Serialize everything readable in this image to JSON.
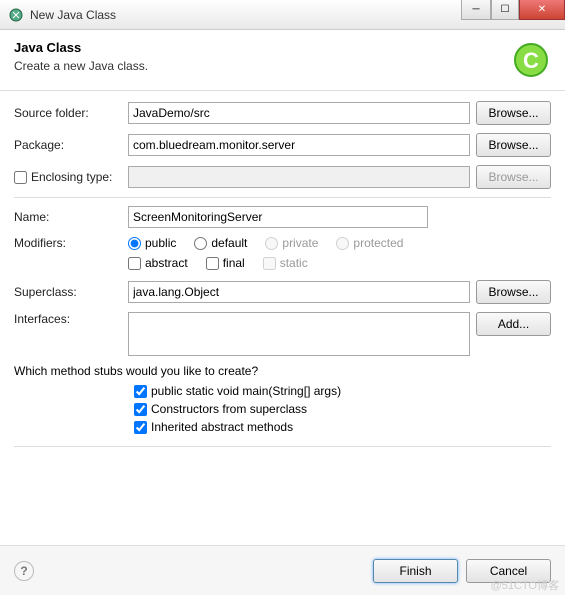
{
  "window": {
    "title": "New Java Class"
  },
  "header": {
    "title": "Java Class",
    "subtitle": "Create a new Java class."
  },
  "fields": {
    "source_folder_label": "Source folder:",
    "source_folder_value": "JavaDemo/src",
    "package_label": "Package:",
    "package_value": "com.bluedream.monitor.server",
    "enclosing_label": "Enclosing type:",
    "enclosing_value": "",
    "name_label": "Name:",
    "name_value": "ScreenMonitoringServer",
    "modifiers_label": "Modifiers:",
    "superclass_label": "Superclass:",
    "superclass_value": "java.lang.Object",
    "interfaces_label": "Interfaces:"
  },
  "modifiers": {
    "public": "public",
    "default": "default",
    "private": "private",
    "protected": "protected",
    "abstract": "abstract",
    "final": "final",
    "static": "static"
  },
  "buttons": {
    "browse": "Browse...",
    "add": "Add...",
    "finish": "Finish",
    "cancel": "Cancel"
  },
  "stubs": {
    "question": "Which method stubs would you like to create?",
    "main": "public static void main(String[] args)",
    "constructors": "Constructors from superclass",
    "inherited": "Inherited abstract methods"
  },
  "watermark": "@51CTO博客"
}
